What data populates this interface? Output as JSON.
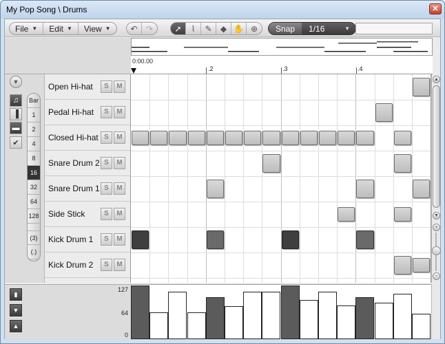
{
  "window": {
    "title": "My Pop Song \\ Drums",
    "close_label": "✕"
  },
  "menus": [
    {
      "label": "File"
    },
    {
      "label": "Edit"
    },
    {
      "label": "View"
    }
  ],
  "snap": {
    "label": "Snap",
    "value": "1/16"
  },
  "ruler": {
    "start_time": "0:00.00",
    "marks": [
      ".2",
      ".3",
      ".4"
    ]
  },
  "zoom": {
    "items": [
      "Bar",
      "1",
      "2",
      "4",
      "8",
      "16",
      "32",
      "64",
      "128"
    ],
    "selected": "16",
    "triplet": "(3)",
    "dotted": "(.)"
  },
  "tracks": [
    {
      "name": "Open Hi-hat",
      "solo": "S",
      "mute": "M"
    },
    {
      "name": "Pedal Hi-hat",
      "solo": "S",
      "mute": "M"
    },
    {
      "name": "Closed Hi-hat",
      "solo": "S",
      "mute": "M"
    },
    {
      "name": "Snare Drum 2",
      "solo": "S",
      "mute": "M"
    },
    {
      "name": "Snare Drum 1",
      "solo": "S",
      "mute": "M"
    },
    {
      "name": "Side Stick",
      "solo": "S",
      "mute": "M"
    },
    {
      "name": "Kick Drum 1",
      "solo": "S",
      "mute": "M"
    },
    {
      "name": "Kick Drum 2",
      "solo": "S",
      "mute": "M"
    }
  ],
  "notes": [
    {
      "track": 0,
      "step": 15,
      "len": 1,
      "level": "light"
    },
    {
      "track": 1,
      "step": 13,
      "len": 1,
      "level": "light"
    },
    {
      "track": 2,
      "step": 0,
      "len": 1,
      "level": "light"
    },
    {
      "track": 2,
      "step": 1,
      "len": 1,
      "level": "light"
    },
    {
      "track": 2,
      "step": 2,
      "len": 1,
      "level": "light"
    },
    {
      "track": 2,
      "step": 3,
      "len": 1,
      "level": "light"
    },
    {
      "track": 2,
      "step": 4,
      "len": 1,
      "level": "light"
    },
    {
      "track": 2,
      "step": 5,
      "len": 1,
      "level": "light"
    },
    {
      "track": 2,
      "step": 6,
      "len": 1,
      "level": "light"
    },
    {
      "track": 2,
      "step": 7,
      "len": 1,
      "level": "light"
    },
    {
      "track": 2,
      "step": 8,
      "len": 1,
      "level": "light"
    },
    {
      "track": 2,
      "step": 9,
      "len": 1,
      "level": "light"
    },
    {
      "track": 2,
      "step": 10,
      "len": 1,
      "level": "light"
    },
    {
      "track": 2,
      "step": 11,
      "len": 1,
      "level": "light"
    },
    {
      "track": 2,
      "step": 12,
      "len": 1,
      "level": "light"
    },
    {
      "track": 2,
      "step": 14,
      "len": 1,
      "level": "light"
    },
    {
      "track": 3,
      "step": 7,
      "len": 1,
      "level": "light"
    },
    {
      "track": 3,
      "step": 14,
      "len": 1,
      "level": "light"
    },
    {
      "track": 4,
      "step": 4,
      "len": 1,
      "level": "light"
    },
    {
      "track": 4,
      "step": 12,
      "len": 1,
      "level": "light"
    },
    {
      "track": 4,
      "step": 15,
      "len": 1,
      "level": "light"
    },
    {
      "track": 5,
      "step": 11,
      "len": 1,
      "level": "light"
    },
    {
      "track": 5,
      "step": 14,
      "len": 1,
      "level": "light"
    },
    {
      "track": 6,
      "step": 0,
      "len": 1,
      "level": "dark"
    },
    {
      "track": 6,
      "step": 4,
      "len": 1,
      "level": "medium"
    },
    {
      "track": 6,
      "step": 8,
      "len": 1,
      "level": "dark"
    },
    {
      "track": 6,
      "step": 12,
      "len": 1,
      "level": "medium"
    },
    {
      "track": 7,
      "step": 14,
      "len": 1,
      "level": "light"
    },
    {
      "track": 7,
      "step": 15,
      "len": 1,
      "level": "light"
    }
  ],
  "velocity": {
    "labels": [
      "127",
      "64",
      "0"
    ],
    "bars": [
      {
        "step": 0,
        "value": 127,
        "dark": true
      },
      {
        "step": 1,
        "value": 64,
        "dark": false
      },
      {
        "step": 2,
        "value": 112,
        "dark": false
      },
      {
        "step": 3,
        "value": 64,
        "dark": false
      },
      {
        "step": 4,
        "value": 100,
        "dark": true
      },
      {
        "step": 5,
        "value": 78,
        "dark": false
      },
      {
        "step": 6,
        "value": 112,
        "dark": false
      },
      {
        "step": 7,
        "value": 112,
        "dark": false
      },
      {
        "step": 8,
        "value": 127,
        "dark": true
      },
      {
        "step": 9,
        "value": 92,
        "dark": false
      },
      {
        "step": 10,
        "value": 112,
        "dark": false
      },
      {
        "step": 11,
        "value": 80,
        "dark": false
      },
      {
        "step": 12,
        "value": 100,
        "dark": true
      },
      {
        "step": 13,
        "value": 86,
        "dark": false
      },
      {
        "step": 14,
        "value": 108,
        "dark": false
      },
      {
        "step": 15,
        "value": 60,
        "dark": false
      }
    ]
  },
  "colors": {
    "accent": "#3a3a3a",
    "note_dark": "#3f3f3f",
    "note_medium": "#6a6a6a",
    "note_light": "#cfcfcf"
  },
  "icons": [
    "undo-icon",
    "redo-icon",
    "arrow-select-icon",
    "pencil-icon",
    "eraser-icon",
    "hand-icon",
    "zoom-tool-icon",
    "headphones-icon",
    "checkmark-icon"
  ]
}
